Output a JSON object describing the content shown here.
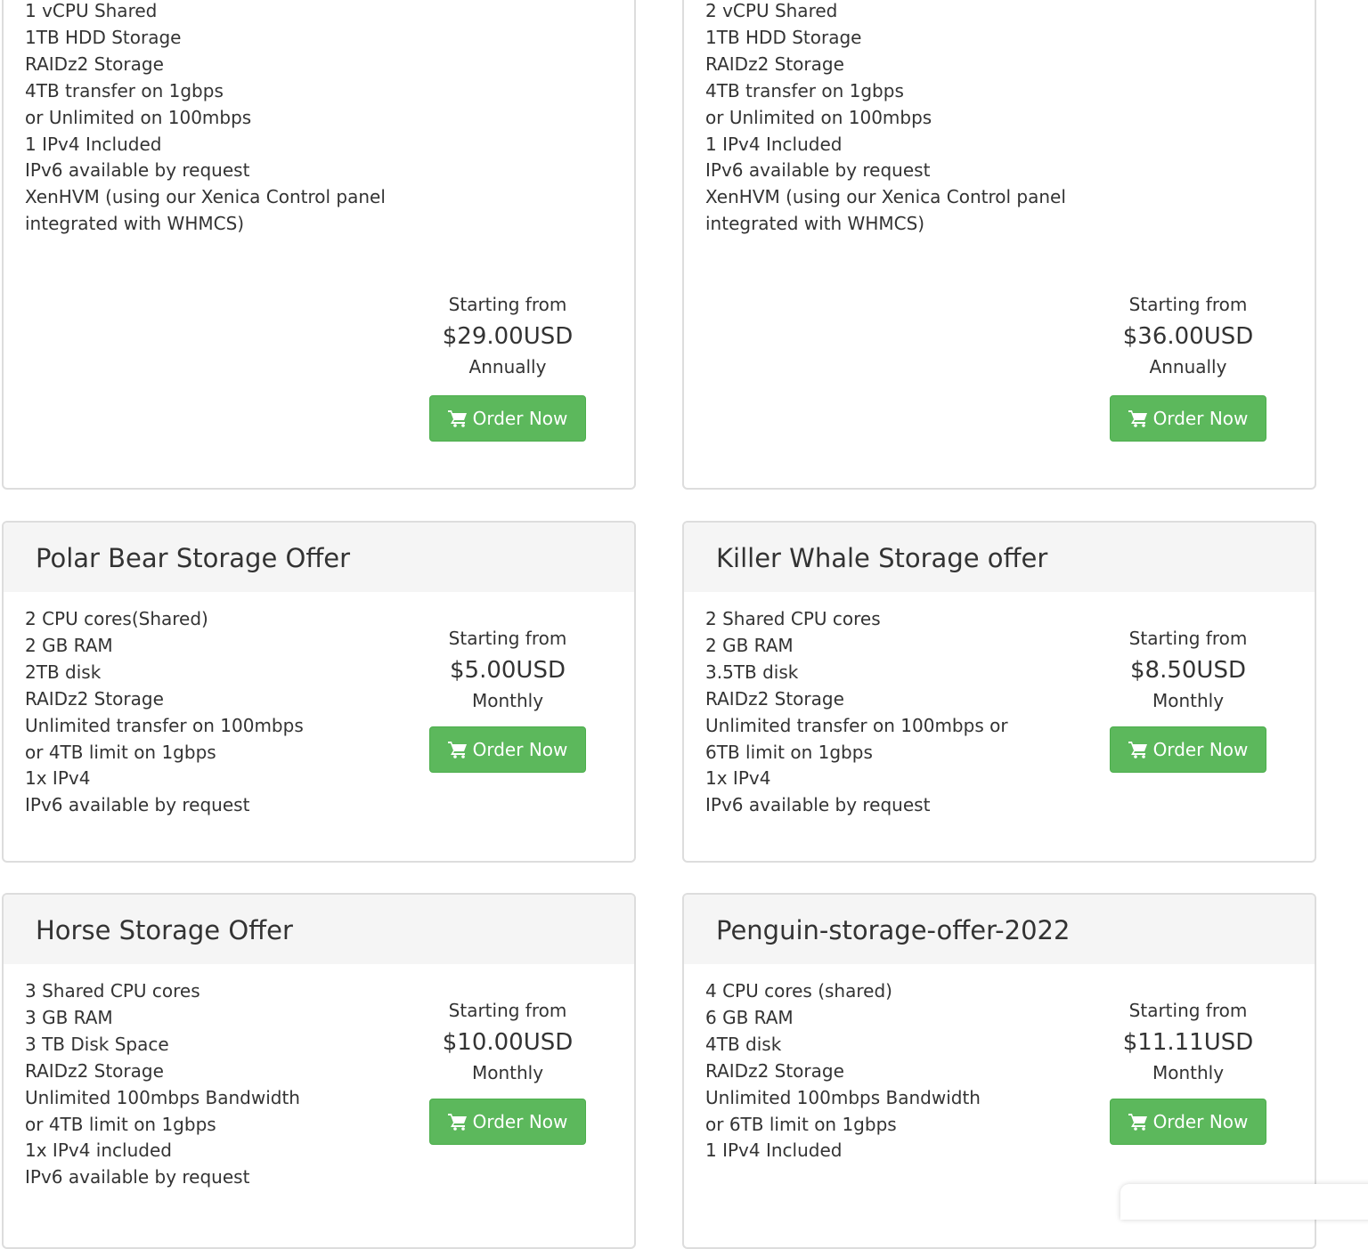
{
  "cards": [
    {
      "title": "",
      "features": [
        "1 vCPU Shared",
        "1TB HDD Storage",
        "RAIDz2 Storage",
        "4TB transfer on 1gbps",
        "or Unlimited on 100mbps",
        "1 IPv4 Included",
        "IPv6 available by request",
        "XenHVM (using our Xenica Control panel",
        "integrated with WHMCS)"
      ],
      "starting_from": "Starting from",
      "price": "$29.00USD",
      "cycle": "Annually",
      "order_label": "Order Now"
    },
    {
      "title": "",
      "features": [
        "2 vCPU Shared",
        "1TB HDD Storage",
        "RAIDz2 Storage",
        "4TB transfer on 1gbps",
        "or Unlimited on 100mbps",
        "1 IPv4 Included",
        "IPv6 available by request",
        "XenHVM (using our Xenica Control panel",
        "integrated with WHMCS)"
      ],
      "starting_from": "Starting from",
      "price": "$36.00USD",
      "cycle": "Annually",
      "order_label": "Order Now"
    },
    {
      "title": "Polar Bear Storage Offer",
      "features": [
        "2 CPU cores(Shared)",
        "2 GB RAM",
        "2TB disk",
        "RAIDz2 Storage",
        "Unlimited transfer on 100mbps",
        "or 4TB limit on 1gbps",
        "1x IPv4",
        "IPv6 available by request"
      ],
      "starting_from": "Starting from",
      "price": "$5.00USD",
      "cycle": "Monthly",
      "order_label": "Order Now"
    },
    {
      "title": "Killer Whale Storage offer",
      "features": [
        "2 Shared CPU cores",
        "2 GB RAM",
        "3.5TB disk",
        "RAIDz2 Storage",
        "Unlimited transfer on 100mbps or",
        "6TB limit on 1gbps",
        "1x IPv4",
        "IPv6 available by request"
      ],
      "starting_from": "Starting from",
      "price": "$8.50USD",
      "cycle": "Monthly",
      "order_label": "Order Now"
    },
    {
      "title": "Horse Storage Offer",
      "features": [
        "3 Shared CPU cores",
        "3 GB RAM",
        "3 TB Disk Space",
        "RAIDz2 Storage",
        "Unlimited 100mbps Bandwidth",
        "or 4TB limit on 1gbps",
        "1x IPv4 included",
        "IPv6 available by request"
      ],
      "starting_from": "Starting from",
      "price": "$10.00USD",
      "cycle": "Monthly",
      "order_label": "Order Now"
    },
    {
      "title": "Penguin-storage-offer-2022",
      "features": [
        "4 CPU cores (shared)",
        "6 GB RAM",
        "4TB disk",
        "RAIDz2 Storage",
        "Unlimited 100mbps Bandwidth",
        "or 6TB limit on 1gbps",
        "1 IPv4 Included"
      ],
      "starting_from": "Starting from",
      "price": "$11.11USD",
      "cycle": "Monthly",
      "order_label": "Order Now"
    }
  ],
  "icons": {
    "order": "shopping-cart-icon"
  },
  "colors": {
    "button": "#5cb85c",
    "header_bg": "#f5f5f5",
    "border": "#dddddd",
    "text": "#333333"
  }
}
